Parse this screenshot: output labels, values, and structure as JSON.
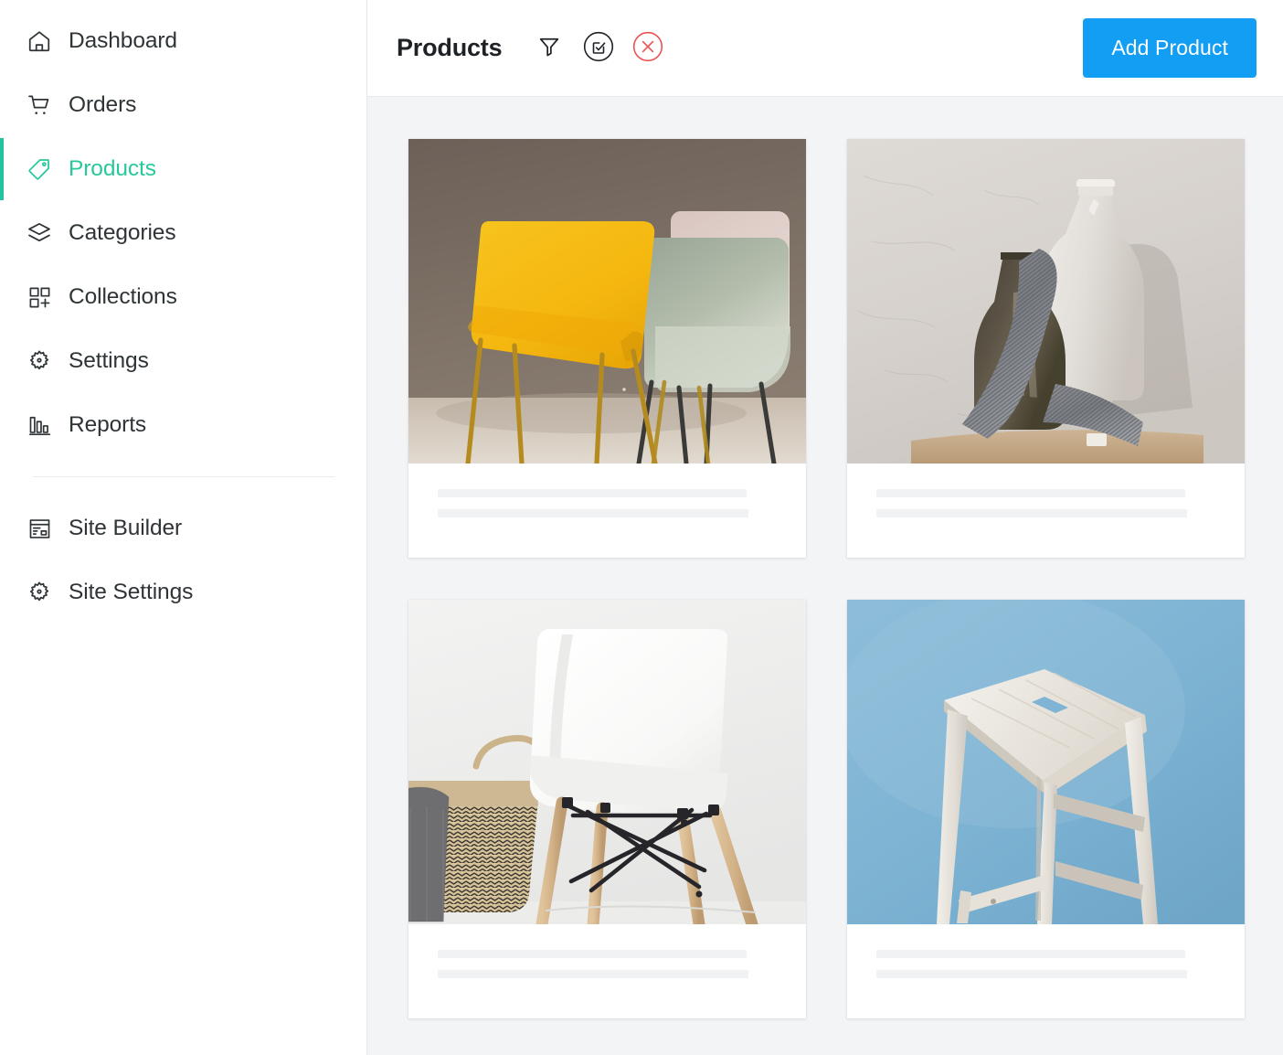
{
  "sidebar": {
    "primary_items": [
      {
        "label": "Dashboard",
        "icon": "home-icon",
        "active": false
      },
      {
        "label": "Orders",
        "icon": "cart-icon",
        "active": false
      },
      {
        "label": "Products",
        "icon": "tag-icon",
        "active": true
      },
      {
        "label": "Categories",
        "icon": "layers-icon",
        "active": false
      },
      {
        "label": "Collections",
        "icon": "grid-plus-icon",
        "active": false
      },
      {
        "label": "Settings",
        "icon": "gear-icon",
        "active": false
      },
      {
        "label": "Reports",
        "icon": "bar-chart-icon",
        "active": false
      }
    ],
    "secondary_items": [
      {
        "label": "Site Builder",
        "icon": "layout-icon"
      },
      {
        "label": "Site Settings",
        "icon": "gear-icon"
      }
    ],
    "active_color": "#23c3a0",
    "text_color": "#2f3437"
  },
  "header": {
    "title": "Products",
    "tools": [
      {
        "name": "filter-icon",
        "label": "Filter"
      },
      {
        "name": "edit-select-icon",
        "label": "Edit selection"
      },
      {
        "name": "close-circle-icon",
        "label": "Clear",
        "color": "#ea5252"
      }
    ],
    "add_button_label": "Add Product",
    "add_button_color": "#119ef3"
  },
  "products": [
    {
      "alt": "Yellow, sage and pink modern dining chairs against brown wall",
      "image": "chairs-yellow-sage"
    },
    {
      "alt": "Olive ceramic vase, white bottle and grey knit throw",
      "image": "vases-bottle-knit"
    },
    {
      "alt": "White moulded chair with wooden legs beside woven basket",
      "image": "white-eames-chair"
    },
    {
      "alt": "White wooden bar stool on blue background",
      "image": "white-bar-stool"
    }
  ],
  "skeleton": {
    "line_color": "#f1f2f3",
    "lines_per_card": 2
  }
}
